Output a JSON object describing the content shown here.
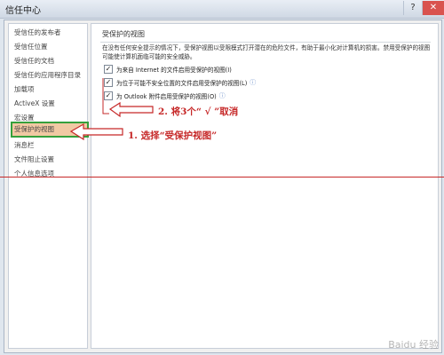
{
  "window": {
    "title": "信任中心",
    "controls": [
      "?",
      "✕"
    ]
  },
  "sidebar": {
    "items": [
      {
        "label": "受信任的发布者"
      },
      {
        "label": "受信任位置"
      },
      {
        "label": "受信任的文档"
      },
      {
        "label": "受信任的应用程序目录"
      },
      {
        "label": "加载项"
      },
      {
        "label": "ActiveX 设置"
      },
      {
        "label": "宏设置"
      },
      {
        "label": "受保护的视图",
        "selected": true
      },
      {
        "label": "消息栏"
      },
      {
        "label": "文件阻止设置"
      },
      {
        "label": "个人信息选项"
      }
    ]
  },
  "main": {
    "section_title": "受保护的视图",
    "description": "在没有任何安全提示的情况下，受保护视图以受限模式打开潜在的危险文件，有助于最小化对计算机的损害。禁用受保护的视图可能使计算机面临可能的安全威胁。",
    "options": [
      {
        "label": "为来自 Internet 的文件启用受保护的视图(I)",
        "checked": true,
        "info": false
      },
      {
        "label": "为位于可能不安全位置的文件启用受保护的视图(L)",
        "checked": true,
        "info": true
      },
      {
        "label": "为 Outlook 附件启用受保护的视图(O)",
        "checked": true,
        "info": true
      }
    ]
  },
  "annotations": {
    "step1": "1. 选择“受保护视图”",
    "step2": "2. 将3个“ √ ”取消",
    "color": "#c62828"
  },
  "watermark": "Baidu 经验"
}
